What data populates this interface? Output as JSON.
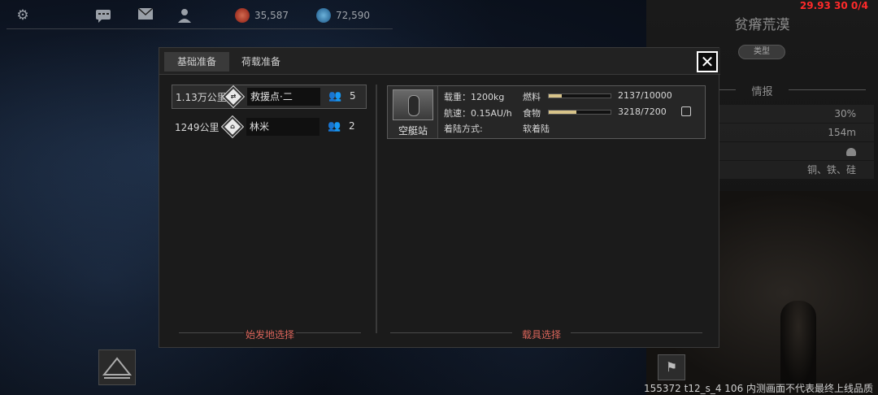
{
  "topbar": {
    "resource_red": "35,587",
    "resource_blue": "72,590"
  },
  "right_panel": {
    "debug": "29.93 30 0/4",
    "title": "贫瘠荒漠",
    "type_label": "类型",
    "info_label": "情报",
    "rows": [
      "30%",
      "154m",
      "",
      "铜、铁、硅"
    ]
  },
  "dialog": {
    "tabs": [
      {
        "label": "基础准备",
        "active": true
      },
      {
        "label": "荷载准备",
        "active": false
      }
    ],
    "close_label": "✕",
    "destinations": [
      {
        "distance": "1.13万公里",
        "icon_glyph": "⇄",
        "name": "救援点·二",
        "count": "5",
        "selected": true
      },
      {
        "distance": "1249公里",
        "icon_glyph": "⌂",
        "name": "林米",
        "count": "2",
        "selected": false
      }
    ],
    "left_section_label": "始发地选择",
    "right_section_label": "载具选择",
    "vehicle": {
      "name": "空艇站",
      "load_label": "载重：1200kg",
      "speed_label": "航速：0.15AU/h",
      "landing_label": "着陆方式:",
      "landing_value": "软着陆",
      "fuel_label": "燃料",
      "fuel_value": "2137/10000",
      "fuel_fraction": 0.2137,
      "food_label": "食物",
      "food_value": "3218/7200",
      "food_fraction": 0.447
    }
  },
  "footer": {
    "build_text": "155372 t12_s_4 106  内测画面不代表最终上线品质"
  },
  "colors": {
    "accent_red": "#d9645a",
    "bar_fill": "#d8c48a",
    "debug_red": "#ff2a2a"
  }
}
